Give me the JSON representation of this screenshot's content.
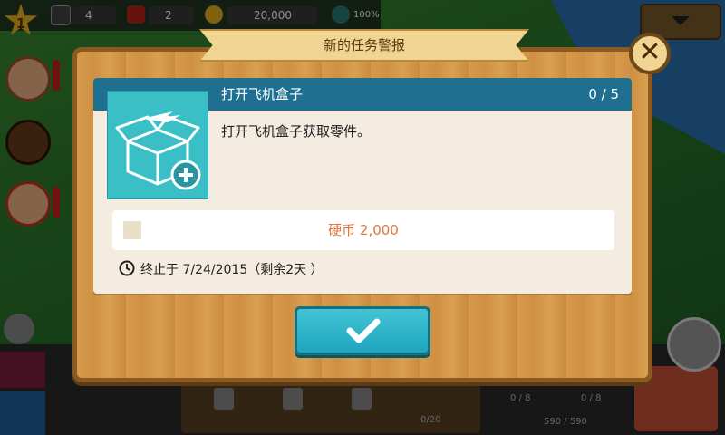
{
  "hud": {
    "level": "1",
    "dice_black": "4",
    "dice_red": "2",
    "coins": "20,000",
    "percent": "100%"
  },
  "modal": {
    "ribbon_title": "新的任务警报",
    "close_symbol": "✕",
    "task": {
      "title": "打开飞机盒子",
      "progress": "0 / 5",
      "description": "打开飞机盒子获取零件。",
      "reward": "硬币 2,000",
      "deadline": "终止于 7/24/2015（剩余2天 ）"
    },
    "confirm_symbol": "✓"
  },
  "bottom": {
    "slot_a": "0 / 8",
    "slot_b": "0 / 8",
    "route_count": "0/20",
    "fuel": "590 / 590"
  },
  "colors": {
    "header_blue": "#1e6f90",
    "reward_orange": "#e0743a",
    "confirm_teal": "#29b4c8",
    "wood": "#d79a4a"
  }
}
